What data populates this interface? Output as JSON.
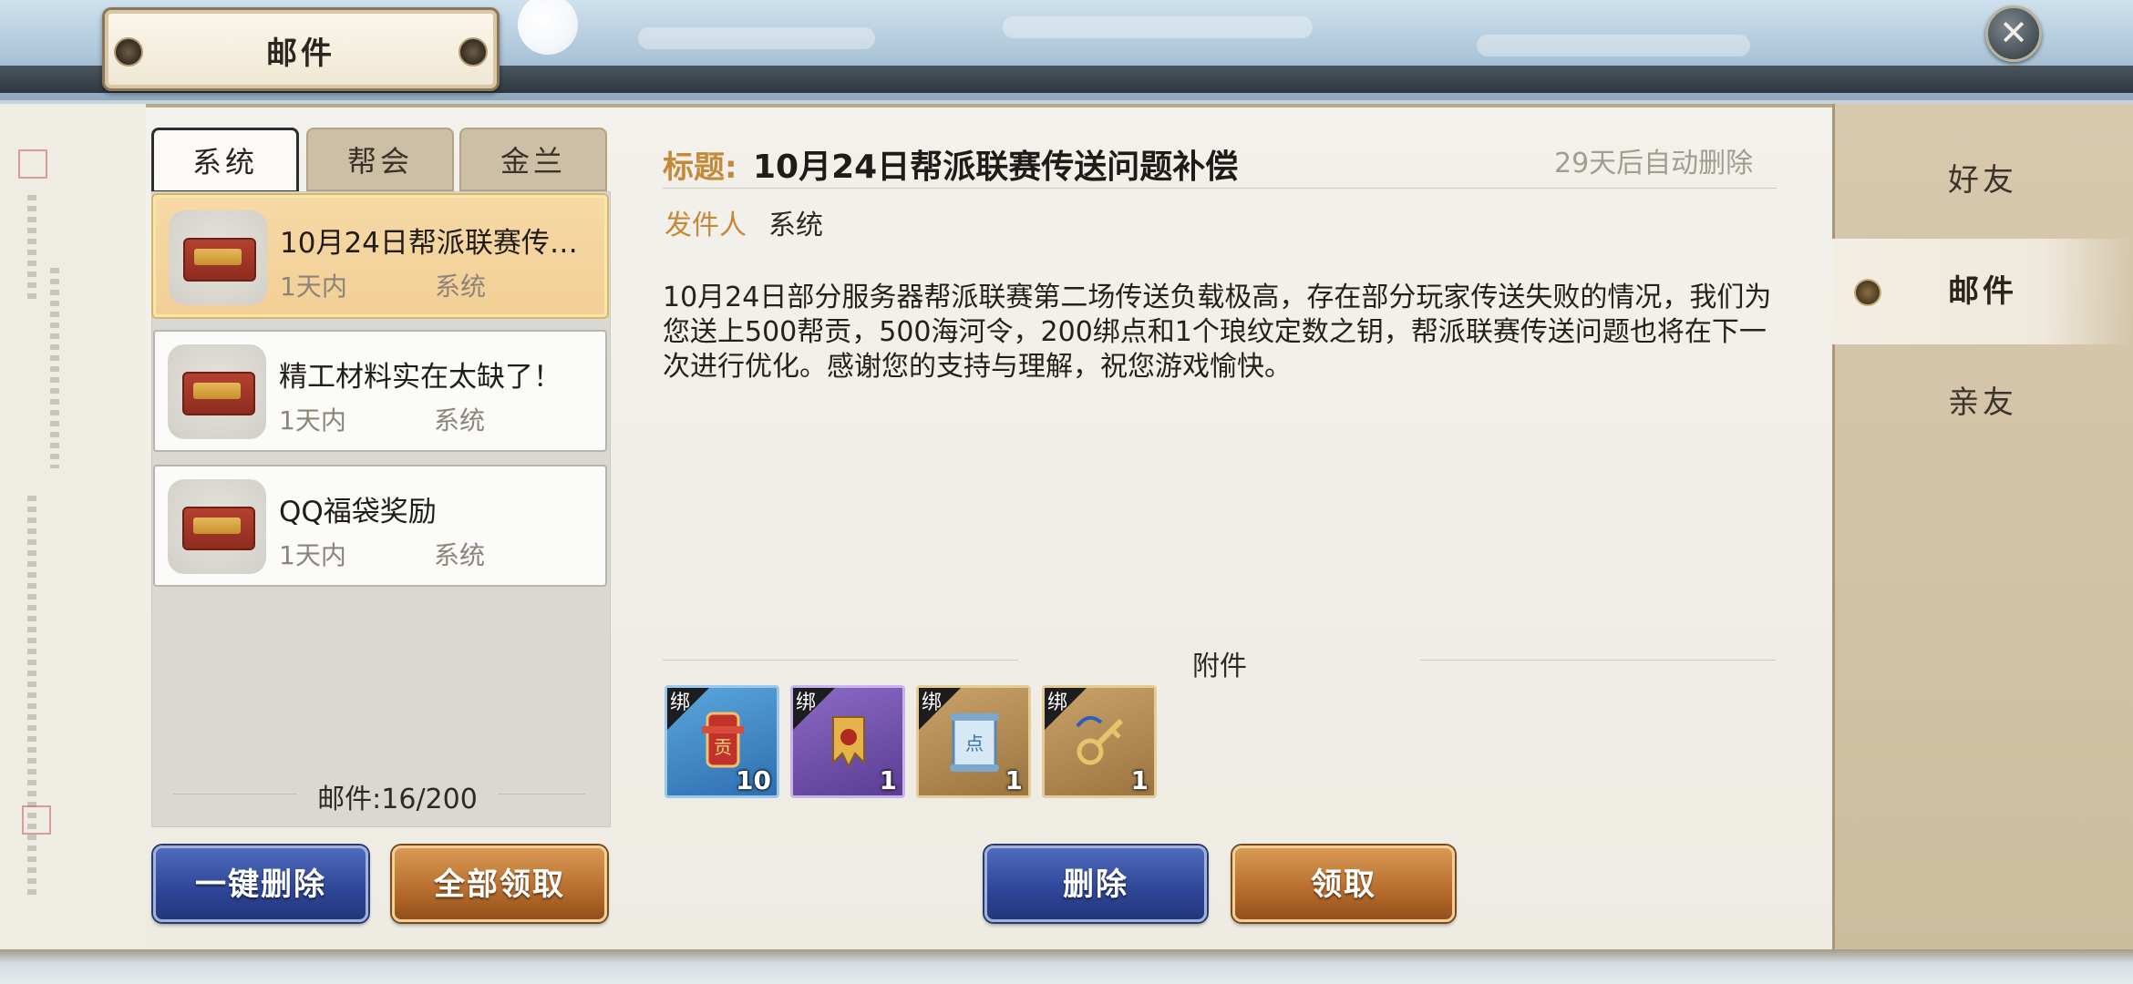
{
  "window": {
    "title": "邮件",
    "close_icon": "close-icon"
  },
  "tabs": [
    {
      "label": "系统",
      "active": true
    },
    {
      "label": "帮会",
      "active": false
    },
    {
      "label": "金兰",
      "active": false
    }
  ],
  "mail_list": [
    {
      "subject": "10月24日帮派联赛传送问题补偿",
      "time": "1天内",
      "from": "系统",
      "selected": true
    },
    {
      "subject": "精工材料实在太缺了！",
      "time": "1天内",
      "from": "系统",
      "selected": false
    },
    {
      "subject": "QQ福袋奖励",
      "time": "1天内",
      "from": "系统",
      "selected": false
    }
  ],
  "mail_count": "邮件:16/200",
  "left_buttons": {
    "delete_all": "一键删除",
    "claim_all": "全部领取"
  },
  "detail": {
    "title_label": "标题:",
    "title": "10月24日帮派联赛传送问题补偿",
    "auto_delete": "29天后自动删除",
    "sender_label": "发件人",
    "sender": "系统",
    "body": "10月24日部分服务器帮派联赛第二场传送负载极高，存在部分玩家传送失败的情况，我们为您送上500帮贡，500海河令，200绑点和1个琅纹定数之钥，帮派联赛传送问题也将在下一次进行优化。感谢您的支持与理解，祝您游戏愉快。",
    "attachments_label": "附件",
    "attachments": [
      {
        "icon": "contribution-token-icon",
        "bind": "绑",
        "qty": "10",
        "color": "blue"
      },
      {
        "icon": "gold-token-icon",
        "bind": "绑",
        "qty": "1",
        "color": "purple"
      },
      {
        "icon": "points-scroll-icon",
        "bind": "绑",
        "qty": "1",
        "color": "tan"
      },
      {
        "icon": "golden-key-icon",
        "bind": "绑",
        "qty": "1",
        "color": "tan"
      }
    ],
    "delete_button": "删除",
    "claim_button": "领取"
  },
  "side_nav": [
    {
      "label": "好友",
      "active": false
    },
    {
      "label": "邮件",
      "active": true
    },
    {
      "label": "亲友",
      "active": false
    }
  ],
  "colors": {
    "accent_gold": "#c48a3a",
    "selected_row": "#f4d49c",
    "button_blue": "#2e4597",
    "button_gold": "#b76c2c"
  }
}
